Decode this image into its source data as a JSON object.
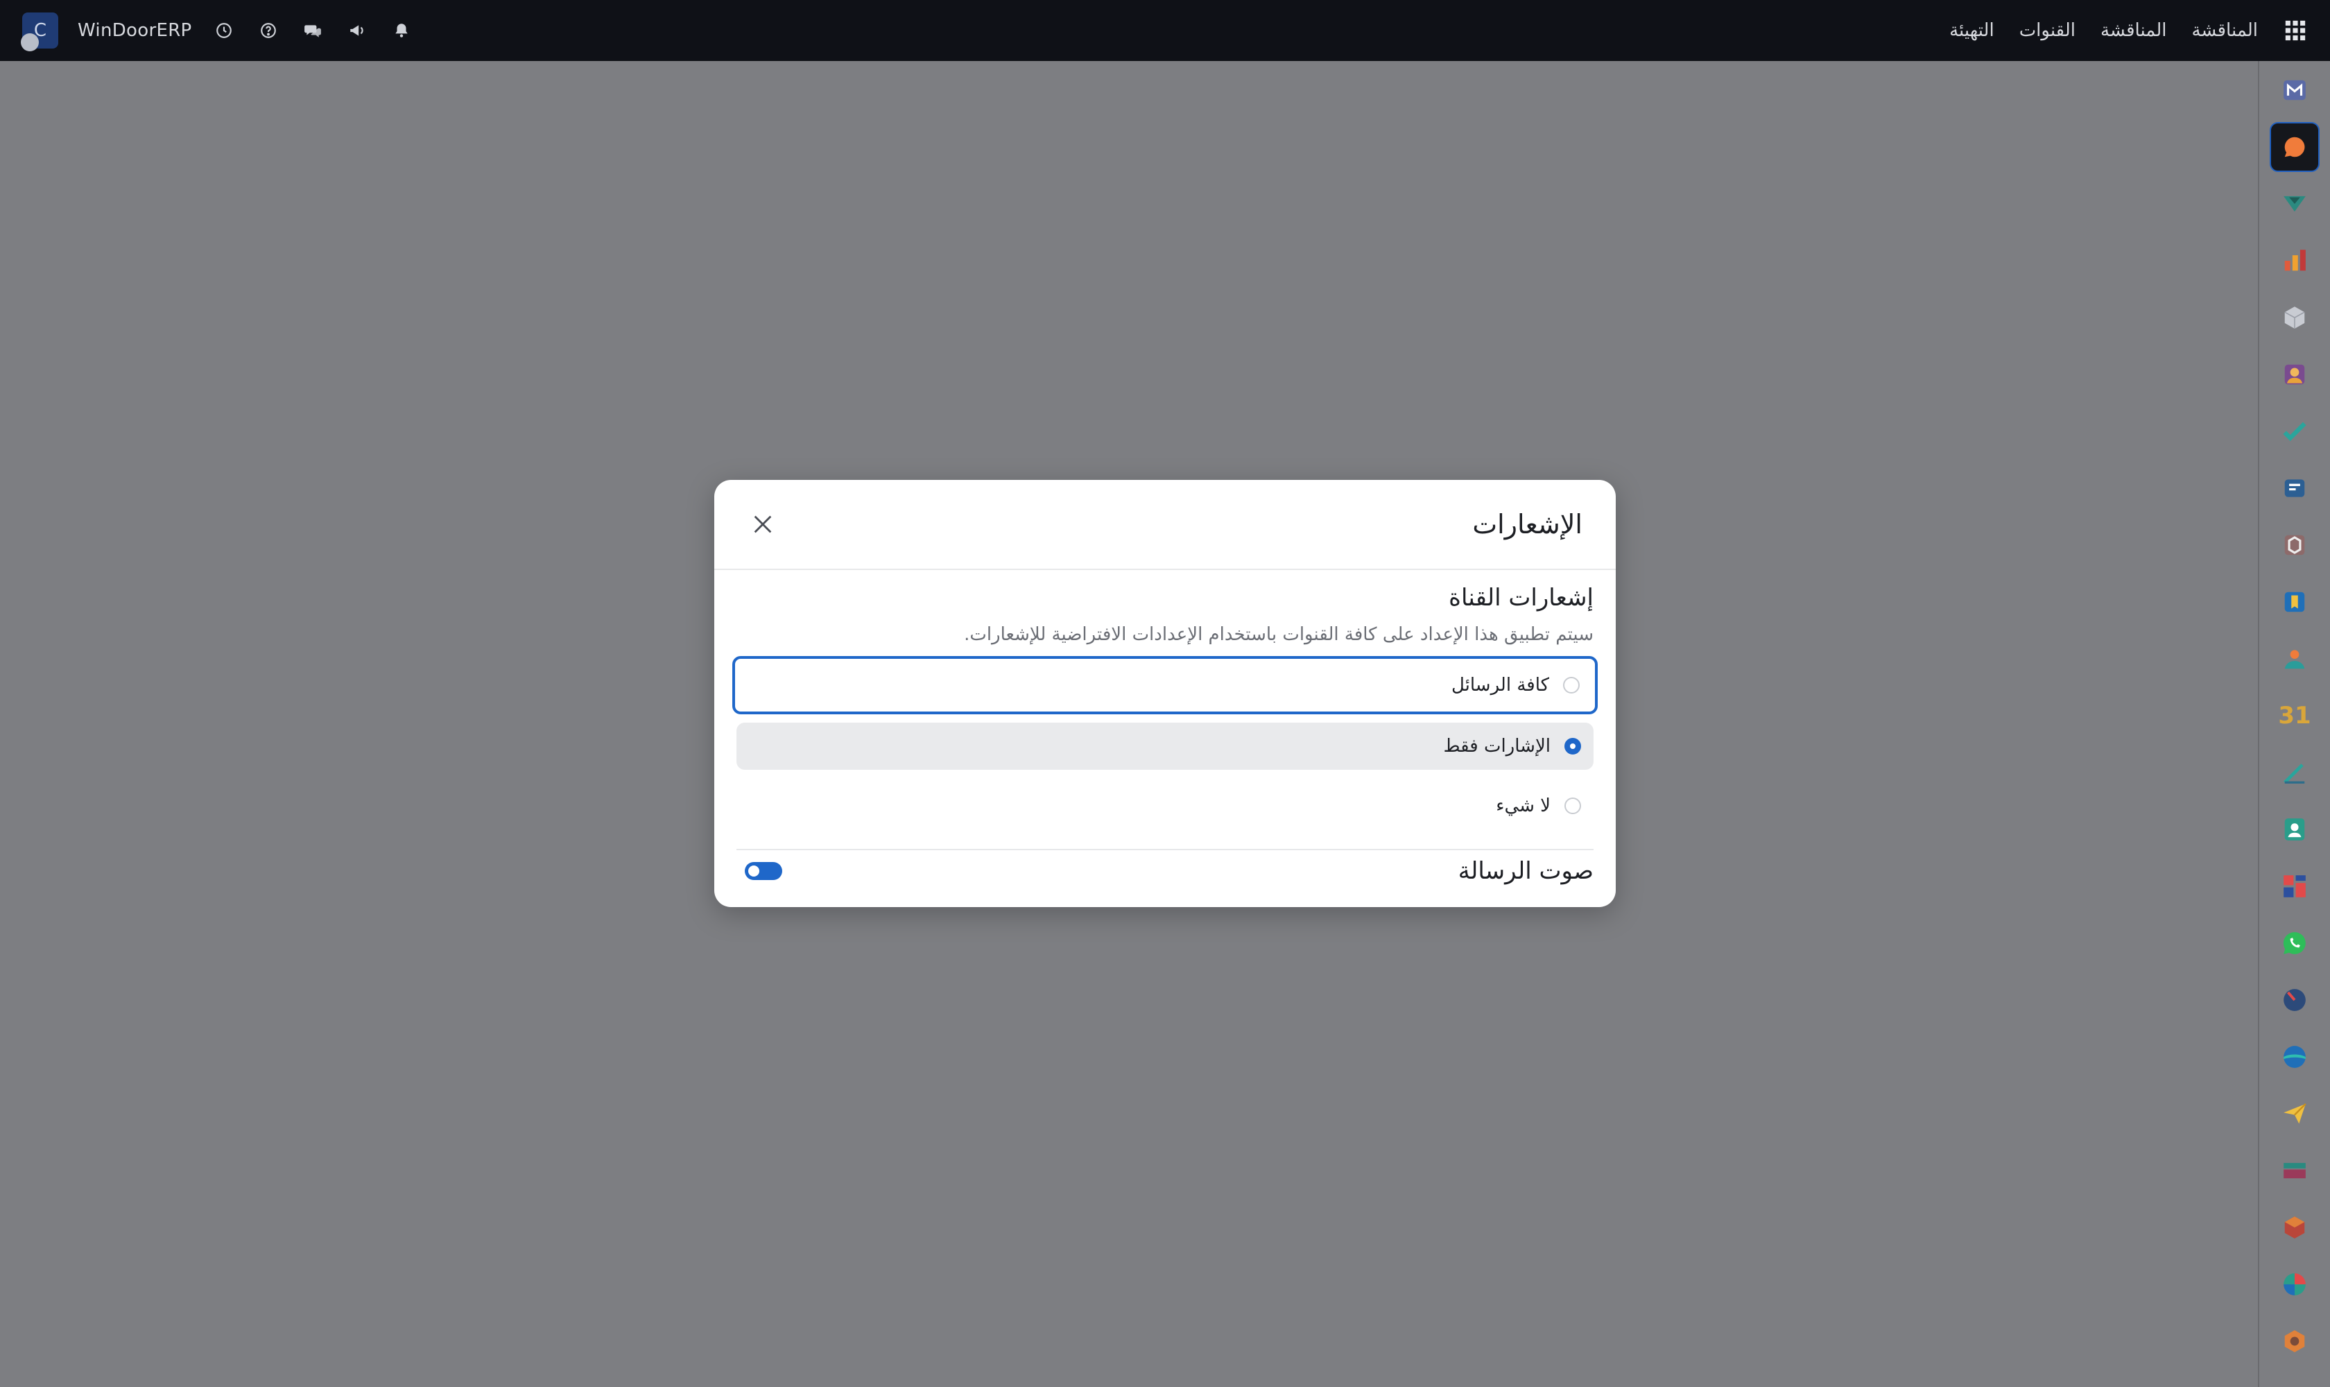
{
  "navbar": {
    "company": "WinDoorERP",
    "logo_letter": "C",
    "links": [
      "المناقشة",
      "المناقشة",
      "القنوات",
      "التهيئة"
    ],
    "icons": [
      "clock-icon",
      "help-icon",
      "chat-icon",
      "megaphone-icon",
      "bell-icon"
    ]
  },
  "dialog": {
    "title": "الإشعارات",
    "section_title": "إشعارات القناة",
    "section_desc": "سيتم تطبيق هذا الإعداد على كافة القنوات باستخدام الإعدادات الافتراضية للإشعارات.",
    "options": [
      {
        "label": "كافة الرسائل",
        "checked": false
      },
      {
        "label": "الإشارات فقط",
        "checked": true
      },
      {
        "label": "لا شيء",
        "checked": false
      }
    ],
    "sound_label": "صوت الرسالة",
    "sound_enabled": true
  },
  "sidebar": {
    "calendar_day": "31",
    "active_index": 1
  },
  "colors": {
    "accent": "#1f67c9",
    "navbar_bg": "#0f1117",
    "overlay": "#7d7e82"
  }
}
